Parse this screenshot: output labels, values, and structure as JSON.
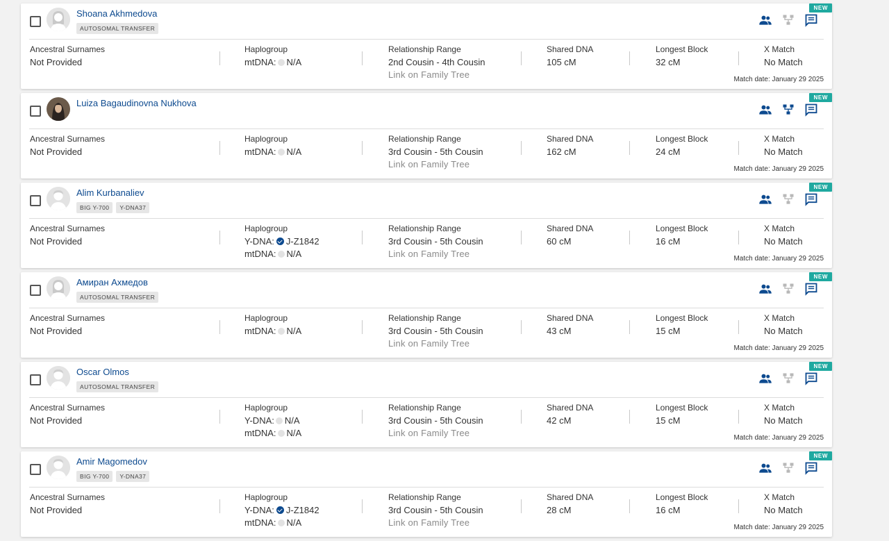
{
  "labels": {
    "ancestral": "Ancestral Surnames",
    "haplogroup": "Haplogroup",
    "relationship": "Relationship Range",
    "shared": "Shared DNA",
    "longest": "Longest Block",
    "xmatch": "X Match",
    "new_badge": "NEW",
    "ydna_prefix": "Y-DNA:",
    "mtdna_prefix": "mtDNA:",
    "link_tree": "Link on Family Tree"
  },
  "matches": [
    {
      "name": "Shoana Akhmedova",
      "avatar": "female-silhouette",
      "tags": [
        "AUTOSOMAL TRANSFER"
      ],
      "surnames": "Not Provided",
      "ydna": null,
      "ydna_verified": false,
      "mtdna": "N/A",
      "relationship": "2nd Cousin - 4th Cousin",
      "shared": "105 cM",
      "longest": "32 cM",
      "xmatch": "No Match",
      "date": "Match date: January 29 2025",
      "tree_active": false
    },
    {
      "name": "Luiza Bagaudinovna Nukhova",
      "avatar": "photo",
      "tags": [],
      "surnames": "Not Provided",
      "ydna": null,
      "ydna_verified": false,
      "mtdna": "N/A",
      "relationship": "3rd Cousin - 5th Cousin",
      "shared": "162 cM",
      "longest": "24 cM",
      "xmatch": "No Match",
      "date": "Match date: January 29 2025",
      "tree_active": true
    },
    {
      "name": "Alim Kurbanaliev",
      "avatar": "male-silhouette",
      "tags": [
        "BIG Y-700",
        "Y-DNA37"
      ],
      "surnames": "Not Provided",
      "ydna": "J-Z1842",
      "ydna_verified": true,
      "mtdna": "N/A",
      "relationship": "3rd Cousin - 5th Cousin",
      "shared": "60 cM",
      "longest": "16 cM",
      "xmatch": "No Match",
      "date": "Match date: January 29 2025",
      "tree_active": false
    },
    {
      "name": "Амиран Ахмедов",
      "avatar": "female-silhouette",
      "tags": [
        "AUTOSOMAL TRANSFER"
      ],
      "surnames": "Not Provided",
      "ydna": null,
      "ydna_verified": false,
      "mtdna": "N/A",
      "relationship": "3rd Cousin - 5th Cousin",
      "shared": "43 cM",
      "longest": "15 cM",
      "xmatch": "No Match",
      "date": "Match date: January 29 2025",
      "tree_active": false
    },
    {
      "name": "Oscar Olmos",
      "avatar": "male-silhouette",
      "tags": [
        "AUTOSOMAL TRANSFER"
      ],
      "surnames": "Not Provided",
      "ydna": "N/A",
      "ydna_verified": false,
      "mtdna": "N/A",
      "relationship": "3rd Cousin - 5th Cousin",
      "shared": "42 cM",
      "longest": "15 cM",
      "xmatch": "No Match",
      "date": "Match date: January 29 2025",
      "tree_active": false
    },
    {
      "name": "Amir Magomedov",
      "avatar": "male-silhouette",
      "tags": [
        "BIG Y-700",
        "Y-DNA37"
      ],
      "surnames": "Not Provided",
      "ydna": "J-Z1842",
      "ydna_verified": true,
      "mtdna": "N/A",
      "relationship": "3rd Cousin - 5th Cousin",
      "shared": "28 cM",
      "longest": "16 cM",
      "xmatch": "No Match",
      "date": "Match date: January 29 2025",
      "tree_active": false
    }
  ],
  "colors": {
    "link_blue": "#0d4a8f",
    "badge_teal": "#1fa9a0",
    "tree_inactive": "#b8b8b8"
  },
  "icons": {
    "people": "people-icon",
    "tree": "family-tree-icon",
    "message": "message-icon"
  }
}
